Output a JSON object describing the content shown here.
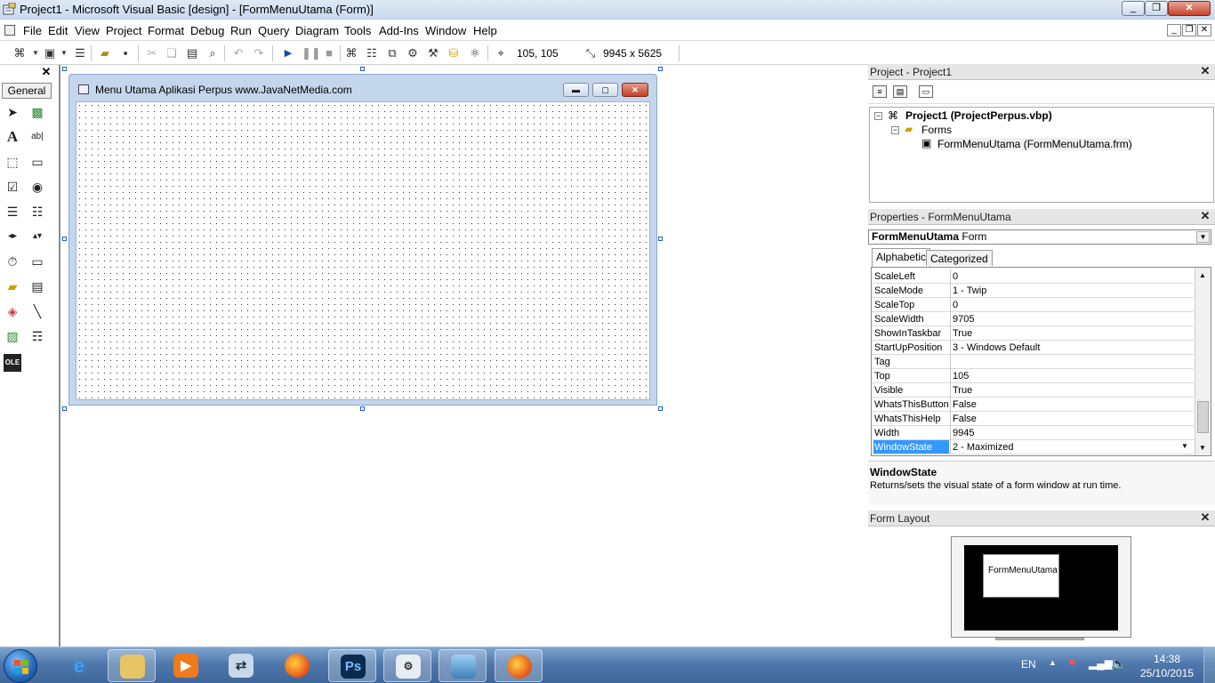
{
  "window": {
    "title": "Project1 - Microsoft Visual Basic [design] - [FormMenuUtama (Form)]"
  },
  "menu": {
    "items": [
      "File",
      "Edit",
      "View",
      "Project",
      "Format",
      "Debug",
      "Run",
      "Query",
      "Diagram",
      "Tools",
      "Add-Ins",
      "Window",
      "Help"
    ]
  },
  "toolbar": {
    "position": "105, 105",
    "size": "9945 x 5625"
  },
  "toolbox": {
    "tab_label": "General"
  },
  "form": {
    "caption": "Menu Utama Aplikasi Perpus www.JavaNetMedia.com"
  },
  "project_panel": {
    "title": "Project - Project1",
    "project_node": "Project1 (ProjectPerpus.vbp)",
    "folder_node": "Forms",
    "form_node": "FormMenuUtama (FormMenuUtama.frm)"
  },
  "properties_panel": {
    "title": "Properties - FormMenuUtama",
    "object_name": "FormMenuUtama",
    "object_type": "Form",
    "tab_alphabetic": "Alphabetic",
    "tab_categorized": "Categorized",
    "rows": [
      {
        "name": "ScaleLeft",
        "value": "0"
      },
      {
        "name": "ScaleMode",
        "value": "1 - Twip"
      },
      {
        "name": "ScaleTop",
        "value": "0"
      },
      {
        "name": "ScaleWidth",
        "value": "9705"
      },
      {
        "name": "ShowInTaskbar",
        "value": "True"
      },
      {
        "name": "StartUpPosition",
        "value": "3 - Windows Default"
      },
      {
        "name": "Tag",
        "value": ""
      },
      {
        "name": "Top",
        "value": "105"
      },
      {
        "name": "Visible",
        "value": "True"
      },
      {
        "name": "WhatsThisButton",
        "value": "False"
      },
      {
        "name": "WhatsThisHelp",
        "value": "False"
      },
      {
        "name": "Width",
        "value": "9945"
      },
      {
        "name": "WindowState",
        "value": "2 - Maximized"
      }
    ],
    "desc_title": "WindowState",
    "desc_text": "Returns/sets the visual state of a form window at run time."
  },
  "form_layout_panel": {
    "title": "Form Layout",
    "form_label": "FormMenuUtama"
  },
  "taskbar": {
    "language": "EN",
    "time": "14:38",
    "date": "25/10/2015",
    "ps_label": "Ps"
  },
  "colors": {
    "accent": "#3399ff",
    "taskbar": "#4f79ad"
  }
}
